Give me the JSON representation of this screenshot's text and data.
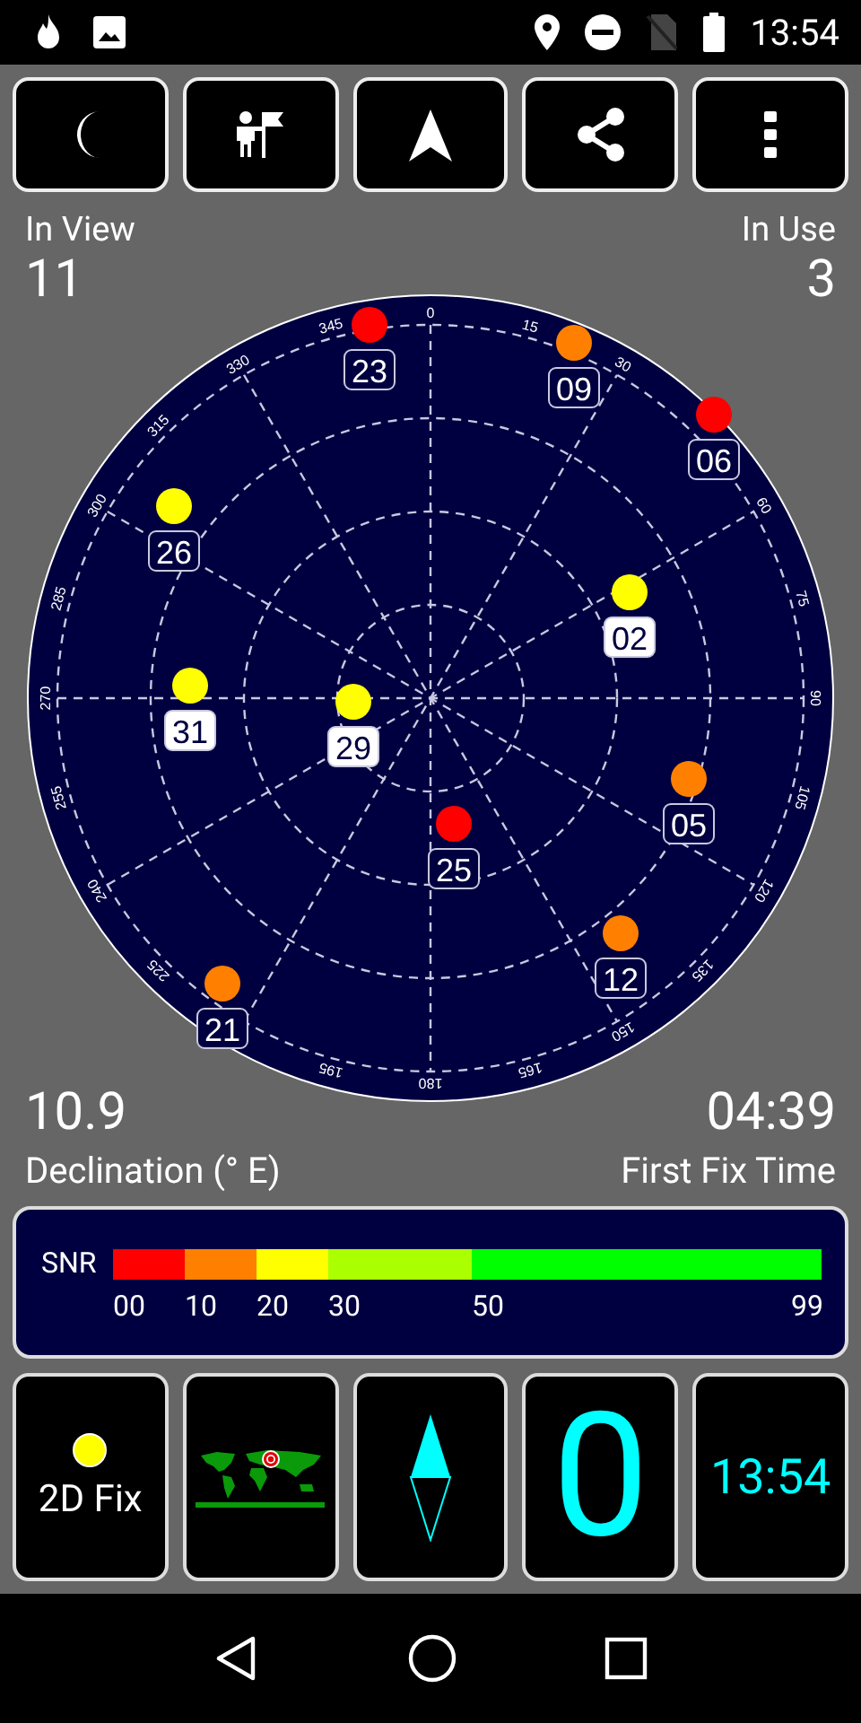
{
  "status_bar": {
    "time": "13:54"
  },
  "toolbar": {
    "buttons": [
      {
        "kind": "night"
      },
      {
        "kind": "person"
      },
      {
        "kind": "navigate"
      },
      {
        "kind": "share"
      },
      {
        "kind": "more"
      }
    ]
  },
  "in_view": {
    "label": "In View",
    "value": "11"
  },
  "in_use": {
    "label": "In Use",
    "value": "3"
  },
  "sky_plot": {
    "bearing_labels": [
      "0",
      "15",
      "30",
      "60",
      "75",
      "90",
      "105",
      "120",
      "135",
      "150",
      "165",
      "180",
      "195",
      "225",
      "240",
      "255",
      "270",
      "285",
      "300",
      "315",
      "330",
      "345"
    ],
    "satellites": [
      {
        "prn": "23",
        "color": "#ff0000",
        "in_use": false
      },
      {
        "prn": "09",
        "color": "#ff8000",
        "in_use": false
      },
      {
        "prn": "06",
        "color": "#ff0000",
        "in_use": false
      },
      {
        "prn": "26",
        "color": "#ffff00",
        "in_use": false
      },
      {
        "prn": "02",
        "color": "#ffff00",
        "in_use": true
      },
      {
        "prn": "31",
        "color": "#ffff00",
        "in_use": true
      },
      {
        "prn": "29",
        "color": "#ffff00",
        "in_use": true
      },
      {
        "prn": "05",
        "color": "#ff8000",
        "in_use": false
      },
      {
        "prn": "25",
        "color": "#ff0000",
        "in_use": false
      },
      {
        "prn": "12",
        "color": "#ff8000",
        "in_use": false
      },
      {
        "prn": "21",
        "color": "#ff8000",
        "in_use": false
      }
    ]
  },
  "declination": {
    "value": "10.9",
    "label": "Declination (° E)"
  },
  "first_fix": {
    "value": "04:39",
    "label": "First Fix Time"
  },
  "snr": {
    "label": "SNR",
    "segments": [
      {
        "color": "#ff0000"
      },
      {
        "color": "#ff8000"
      },
      {
        "color": "#ffff00"
      },
      {
        "color": "#aaff00"
      },
      {
        "color": "#00ff00"
      }
    ],
    "ticks": [
      "00",
      "10",
      "20",
      "30",
      "50",
      "99"
    ]
  },
  "tiles": [
    {
      "kind": "fix",
      "text": "2D Fix"
    },
    {
      "kind": "map"
    },
    {
      "kind": "compass"
    },
    {
      "kind": "count",
      "text": "0"
    },
    {
      "kind": "clock",
      "text": "13:54"
    }
  ]
}
